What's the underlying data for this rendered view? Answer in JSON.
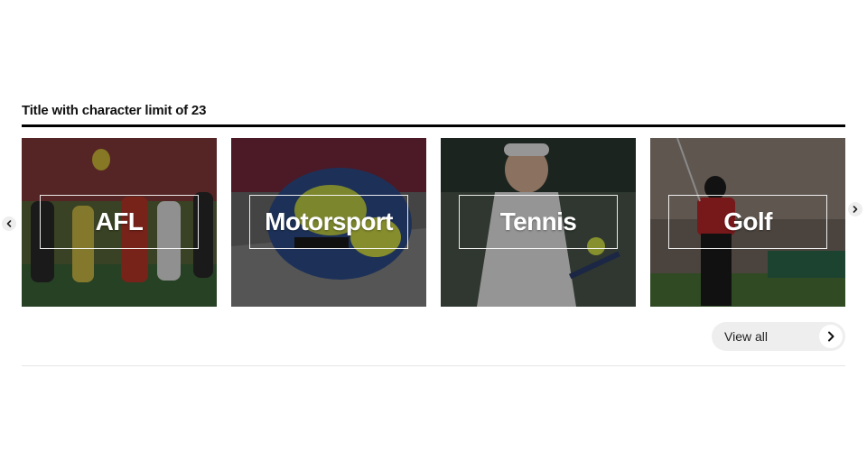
{
  "section": {
    "title": "Title with character limit of 23"
  },
  "cards": [
    {
      "label": "AFL",
      "image": "afl-players-photo"
    },
    {
      "label": "Motorsport",
      "image": "motorcycle-helmet-photo"
    },
    {
      "label": "Tennis",
      "image": "tennis-player-photo"
    },
    {
      "label": "Golf",
      "image": "golfer-photo"
    }
  ],
  "navigation": {
    "prev_icon": "chevron-left-icon",
    "next_icon": "chevron-right-icon"
  },
  "view_all": {
    "label": "View all",
    "icon": "chevron-right-icon"
  },
  "colors": {
    "rule": "#000000",
    "button_bg": "#eeeeee",
    "card_label": "#ffffff"
  }
}
